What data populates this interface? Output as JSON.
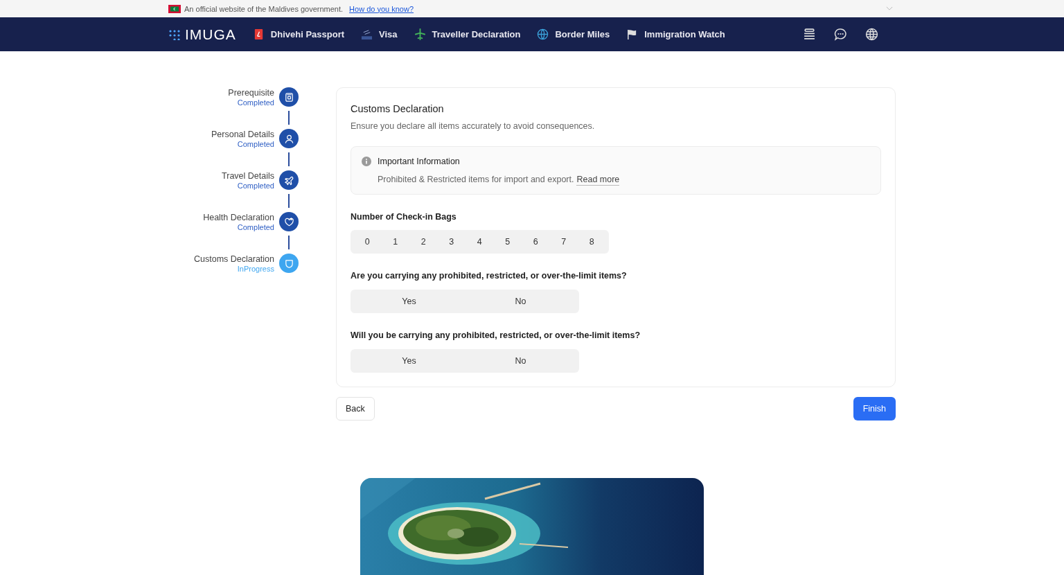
{
  "gov_banner": {
    "text": "An official website of the Maldives government.",
    "link": "How do you know?"
  },
  "nav": {
    "logo": "IMUGA",
    "items": [
      {
        "label": "Dhivehi Passport",
        "kind": "passport"
      },
      {
        "label": "Visa",
        "kind": "visa"
      },
      {
        "label": "Traveller Declaration",
        "kind": "plane"
      },
      {
        "label": "Border Miles",
        "kind": "globe"
      },
      {
        "label": "Immigration Watch",
        "kind": "flag"
      }
    ]
  },
  "steps": [
    {
      "title": "Prerequisite",
      "status": "Completed",
      "kind": "completed"
    },
    {
      "title": "Personal Details",
      "status": "Completed",
      "kind": "completed"
    },
    {
      "title": "Travel Details",
      "status": "Completed",
      "kind": "completed"
    },
    {
      "title": "Health Declaration",
      "status": "Completed",
      "kind": "completed"
    },
    {
      "title": "Customs Declaration",
      "status": "InProgress",
      "kind": "in_progress"
    }
  ],
  "form": {
    "title": "Customs Declaration",
    "subtitle": "Ensure you declare all items accurately to avoid consequences.",
    "info": {
      "title": "Important Information",
      "text": "Prohibited & Restricted items for import and export.",
      "link": "Read more"
    },
    "bags": {
      "label": "Number of Check-in Bags",
      "options": [
        {
          "label": "0",
          "selected": false
        },
        {
          "label": "1",
          "selected": false
        },
        {
          "label": "2",
          "selected": false
        },
        {
          "label": "3",
          "selected": false
        },
        {
          "label": "4",
          "selected": false
        },
        {
          "label": "5",
          "selected": false
        },
        {
          "label": "6",
          "selected": false
        },
        {
          "label": "7",
          "selected": false
        },
        {
          "label": "8",
          "selected": false
        }
      ]
    },
    "questions": [
      {
        "label": "Are you carrying any prohibited, restricted, or over-the-limit items?",
        "options": [
          {
            "label": "Yes",
            "selected": false
          },
          {
            "label": "No",
            "selected": false
          }
        ]
      },
      {
        "label": "Will you be carrying any prohibited, restricted, or over-the-limit items?",
        "options": [
          {
            "label": "Yes",
            "selected": false
          },
          {
            "label": "No",
            "selected": false
          }
        ]
      }
    ]
  },
  "buttons": {
    "back": "Back",
    "finish": "Finish"
  }
}
